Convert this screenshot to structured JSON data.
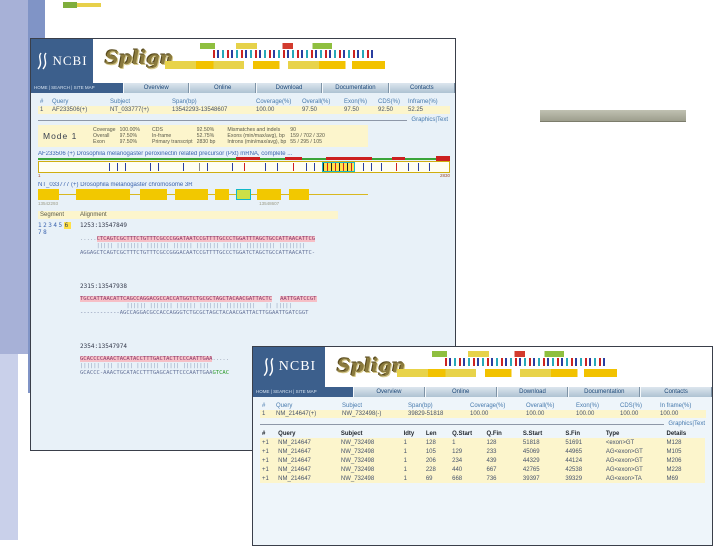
{
  "win1": {
    "ncbi": "NCBI",
    "splign": "Splign",
    "mini_nav": "HOME | SEARCH | SITE MAP",
    "nav": [
      "Overview",
      "Online",
      "Download",
      "Documentation",
      "Contacts"
    ],
    "summary": {
      "headers": [
        "#",
        "Query",
        "Subject",
        "Span(bp)",
        "Coverage(%)",
        "Overall(%)",
        "Exon(%)",
        "CDS(%)",
        "Inframe(%)"
      ],
      "rows": [
        [
          "1",
          "AF233506(+)",
          "NT_033777(+)",
          "13542293-13548607",
          "100.00",
          "97.50",
          "97.50",
          "92.50",
          "52.25"
        ]
      ]
    },
    "graphics_link": "Graphics|Text",
    "mode": {
      "title": "Mode 1",
      "g1": [
        [
          "Coverage",
          "100.00%"
        ],
        [
          "Overall",
          "97.50%"
        ],
        [
          "Exon",
          "97.50%"
        ]
      ],
      "g2": [
        [
          "CDS",
          "92.50%"
        ],
        [
          "In-frame",
          "52.75%"
        ],
        [
          "Primary transcript",
          "2830 bp"
        ]
      ],
      "g3": [
        [
          "Mismatches and indels",
          "90"
        ],
        [
          "Exons (min/max/avg), bp",
          "159 / 702 / 320"
        ],
        [
          "Introns (min/max/avg), bp",
          "55 / 295 / 105"
        ]
      ]
    },
    "query_link": "AF233506 (+) Drosophila melanogaster peroxinectin related precursor (Pxt) mRNA, complete ...",
    "query_scale_start": "1",
    "query_scale_end": "2830",
    "subject_link": "NT_033777 (+) Drosophila melanogaster chromosome 3R",
    "subject_scale_start": "13542293",
    "subject_scale_end": "13548607",
    "segment_section": {
      "col_segment": "Segment",
      "col_alignment": "Alignment",
      "seg_links": "12345",
      "seg_active": "6",
      "seg_links2": "78",
      "blocks": [
        {
          "coord": "1253:13547849",
          "q_pre": ".....",
          "q_seq": "CTCAGTCGCTTTCTGTTTCGCCCGGATAATCCGTTTTGCCCTGGATTTAGCTGCCATTAACATTCG",
          "match": "     ||||| |||||||| ||||||| |||||| ||||||| |||||| ||||||||| ||||||||",
          "s_seq": "AGGAGCTCAGTCGCTTTCTGTTTCGCCGGGACAATCCGTTTTGCCCTGGATCTAGCTGCCATTAACATTC-"
        },
        {
          "coord": "2315:13547938",
          "q_seq": "TGCCATTAACATTCAGCCAGGACGCCACCATGGTCTGCGCTAGCTACAACGATTACTC",
          "q_seq2": "AATTGATCCGT",
          "match": "              |||||| ||||||| |||||| ||||||| |||||||||   || |||||",
          "s_seq": "------------AGCCAGGACGCCACCAGGGTCTGCGCTAGCTACAACGATTACTTGGAATTGATCGGT"
        },
        {
          "coord": "2354:13547974",
          "q_seq": "GCACCCCAAACTACATACCTTTGACTACTTCCCAATTGAA",
          "q_post": ".....",
          "match": "|||||| ||| ||||| ||||||| ||||| ||||||||",
          "s_seq": "GCACCC-AAACTGCATACCTTTGAGCACTTCCCAATTGAA",
          "s_tail": "GTCAC"
        }
      ]
    }
  },
  "win2": {
    "ncbi": "NCBI",
    "splign": "Splign",
    "mini_nav": "HOME | SEARCH | SITE MAP",
    "nav": [
      "Overview",
      "Online",
      "Download",
      "Documentation",
      "Contacts"
    ],
    "summary": {
      "headers": [
        "#",
        "Query",
        "Subject",
        "Span(bp)",
        "Coverage(%)",
        "Overall(%)",
        "Exon(%)",
        "CDS(%)",
        "In frame(%)"
      ],
      "rows": [
        [
          "1",
          "NM_214647(+)",
          "NW_732498(-)",
          "39829-51818",
          "100.00",
          "100.00",
          "100.00",
          "100.00",
          "100.00"
        ]
      ]
    },
    "graphics_link": "Graphics|Text",
    "details": {
      "headers": [
        "#",
        "Query",
        "Subject",
        "Idty",
        "Len",
        "Q.Start",
        "Q.Fin",
        "S.Start",
        "S.Fin",
        "Type",
        "Details"
      ],
      "rows": [
        [
          "+1",
          "NM_214647",
          "NW_732498",
          "1",
          "128",
          "1",
          "128",
          "51818",
          "51691",
          "<exon>GT",
          "M128"
        ],
        [
          "+1",
          "NM_214647",
          "NW_732498",
          "1",
          "105",
          "129",
          "233",
          "45069",
          "44965",
          "AG<exon>GT",
          "M105"
        ],
        [
          "+1",
          "NM_214647",
          "NW_732498",
          "1",
          "206",
          "234",
          "439",
          "44329",
          "44124",
          "AG<exon>GT",
          "M206"
        ],
        [
          "+1",
          "NM_214647",
          "NW_732498",
          "1",
          "228",
          "440",
          "667",
          "42765",
          "42538",
          "AG<exon>GT",
          "M228"
        ],
        [
          "+1",
          "NM_214647",
          "NW_732498",
          "1",
          "69",
          "668",
          "736",
          "39397",
          "39329",
          "AG<exon>TA",
          "M69"
        ]
      ]
    }
  }
}
